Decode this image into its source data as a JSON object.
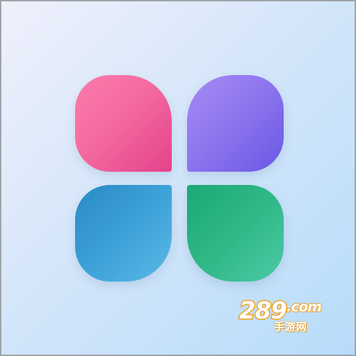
{
  "icon": {
    "tiles": [
      {
        "position": "top-left",
        "color": "#f46aa0"
      },
      {
        "position": "top-right",
        "color": "#8f76ef"
      },
      {
        "position": "bottom-left",
        "color": "#3da2d8"
      },
      {
        "position": "bottom-right",
        "color": "#31b887"
      }
    ],
    "background_color": "#c9e2f9"
  },
  "watermark": {
    "number": "289",
    "domain": ".com",
    "subtitle": "手游网",
    "color": "#f2a11d"
  }
}
